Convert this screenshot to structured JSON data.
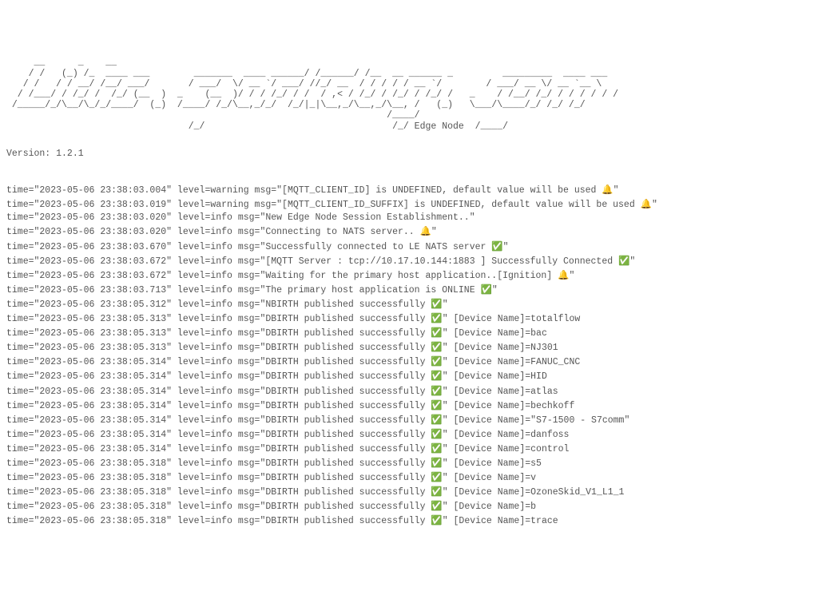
{
  "ascii_art": "     __      _    __\n    / /   (_) /_  ____ ___        _______  ____ ______/ /______/ /__  __ ______ _         _________  ____ ___\n   / /   / / __/ /__/ ___/       / ___/  \\/ __ `/ ___/ //_/ __  / / / / / __ `/        / ___/ __ \\/ __ `__ \\\n  / /___/ / /_/ /  /_/ (__  )  _    (__  )/ / / /_/ / /  / ,< / /_/ / /_/ / /_/ /   _    / /__/ /_/ / / / / / /\n /_____/_/\\__/\\_/_/____/  (_)  /____/ /_/\\__,_/_/  /_/|_|\\__,_/\\__,_/\\__, /   (_)   \\___/\\____/_/ /_/ /_/\n                                                                     /____/\n                                 /_/                                  /_/ Edge Node  /____/",
  "version": "Version: 1.2.1",
  "logs": [
    {
      "time": "2023-05-06 23:38:03.004",
      "level": "warning",
      "msg": "[MQTT_CLIENT_ID] is UNDEFINED, default value will be used ",
      "emoji": "🔔",
      "suffix": ""
    },
    {
      "time": "2023-05-06 23:38:03.019",
      "level": "warning",
      "msg": "[MQTT_CLIENT_ID_SUFFIX] is UNDEFINED, default value will be used ",
      "emoji": "🔔",
      "suffix": ""
    },
    {
      "time": "2023-05-06 23:38:03.020",
      "level": "info",
      "msg": "New Edge Node Session Establishment..",
      "emoji": "",
      "suffix": ""
    },
    {
      "time": "2023-05-06 23:38:03.020",
      "level": "info",
      "msg": "Connecting to NATS server.. ",
      "emoji": "🔔",
      "suffix": ""
    },
    {
      "time": "2023-05-06 23:38:03.670",
      "level": "info",
      "msg": "Successfully connected to LE NATS server ",
      "emoji": "✅",
      "suffix": ""
    },
    {
      "time": "2023-05-06 23:38:03.672",
      "level": "info",
      "msg": "[MQTT Server : tcp://10.17.10.144:1883 ] Successfully Connected ",
      "emoji": "✅",
      "suffix": ""
    },
    {
      "time": "2023-05-06 23:38:03.672",
      "level": "info",
      "msg": "Waiting for the primary host application..[Ignition] ",
      "emoji": "🔔",
      "suffix": ""
    },
    {
      "time": "2023-05-06 23:38:03.713",
      "level": "info",
      "msg": "The primary host application is ONLINE ",
      "emoji": "✅",
      "suffix": ""
    },
    {
      "time": "2023-05-06 23:38:05.312",
      "level": "info",
      "msg": "NBIRTH published successfully ",
      "emoji": "✅",
      "suffix": ""
    },
    {
      "time": "2023-05-06 23:38:05.313",
      "level": "info",
      "msg": "DBIRTH published successfully ",
      "emoji": "✅",
      "suffix": " [Device Name]=totalflow"
    },
    {
      "time": "2023-05-06 23:38:05.313",
      "level": "info",
      "msg": "DBIRTH published successfully ",
      "emoji": "✅",
      "suffix": " [Device Name]=bac"
    },
    {
      "time": "2023-05-06 23:38:05.313",
      "level": "info",
      "msg": "DBIRTH published successfully ",
      "emoji": "✅",
      "suffix": " [Device Name]=NJ301"
    },
    {
      "time": "2023-05-06 23:38:05.314",
      "level": "info",
      "msg": "DBIRTH published successfully ",
      "emoji": "✅",
      "suffix": " [Device Name]=FANUC_CNC"
    },
    {
      "time": "2023-05-06 23:38:05.314",
      "level": "info",
      "msg": "DBIRTH published successfully ",
      "emoji": "✅",
      "suffix": " [Device Name]=HID"
    },
    {
      "time": "2023-05-06 23:38:05.314",
      "level": "info",
      "msg": "DBIRTH published successfully ",
      "emoji": "✅",
      "suffix": " [Device Name]=atlas"
    },
    {
      "time": "2023-05-06 23:38:05.314",
      "level": "info",
      "msg": "DBIRTH published successfully ",
      "emoji": "✅",
      "suffix": " [Device Name]=bechkoff"
    },
    {
      "time": "2023-05-06 23:38:05.314",
      "level": "info",
      "msg": "DBIRTH published successfully ",
      "emoji": "✅",
      "suffix": " [Device Name]=\"S7-1500 - S7comm\""
    },
    {
      "time": "2023-05-06 23:38:05.314",
      "level": "info",
      "msg": "DBIRTH published successfully ",
      "emoji": "✅",
      "suffix": " [Device Name]=danfoss"
    },
    {
      "time": "2023-05-06 23:38:05.314",
      "level": "info",
      "msg": "DBIRTH published successfully ",
      "emoji": "✅",
      "suffix": " [Device Name]=control"
    },
    {
      "time": "2023-05-06 23:38:05.318",
      "level": "info",
      "msg": "DBIRTH published successfully ",
      "emoji": "✅",
      "suffix": " [Device Name]=s5"
    },
    {
      "time": "2023-05-06 23:38:05.318",
      "level": "info",
      "msg": "DBIRTH published successfully ",
      "emoji": "✅",
      "suffix": " [Device Name]=v"
    },
    {
      "time": "2023-05-06 23:38:05.318",
      "level": "info",
      "msg": "DBIRTH published successfully ",
      "emoji": "✅",
      "suffix": " [Device Name]=OzoneSkid_V1_L1_1"
    },
    {
      "time": "2023-05-06 23:38:05.318",
      "level": "info",
      "msg": "DBIRTH published successfully ",
      "emoji": "✅",
      "suffix": " [Device Name]=b"
    },
    {
      "time": "2023-05-06 23:38:05.318",
      "level": "info",
      "msg": "DBIRTH published successfully ",
      "emoji": "✅",
      "suffix": " [Device Name]=trace"
    }
  ]
}
